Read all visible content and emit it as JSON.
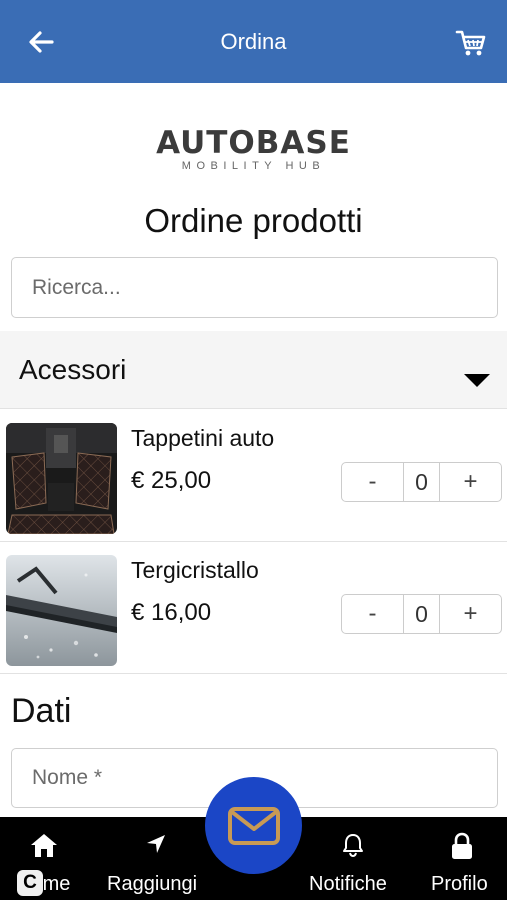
{
  "header": {
    "title": "Ordina"
  },
  "logo": {
    "brand": "AUTOBASE",
    "subtitle": "MOBILITY HUB"
  },
  "page_title": "Ordine prodotti",
  "search": {
    "placeholder": "Ricerca...",
    "value": ""
  },
  "category": {
    "label": "Acessori"
  },
  "products": [
    {
      "name": "Tappetini auto",
      "price": "€ 25,00",
      "quantity": "0",
      "minus": "-",
      "plus": "+"
    },
    {
      "name": "Tergicristallo",
      "price": "€ 16,00",
      "quantity": "0",
      "minus": "-",
      "plus": "+"
    }
  ],
  "form": {
    "section_title": "Dati",
    "name_placeholder": "Nome *"
  },
  "bottom_nav": {
    "items": [
      {
        "label": "Home",
        "icon": "home-icon"
      },
      {
        "label": "Raggiungi",
        "icon": "navigation-arrow-icon"
      },
      {
        "label": "Notifiche",
        "icon": "bell-icon"
      },
      {
        "label": "Profilo",
        "icon": "lock-icon"
      }
    ],
    "fab_icon": "mail-icon"
  },
  "overlay_badge": "C",
  "colors": {
    "header": "#3a6db5",
    "fab": "#1b46c6",
    "fab_icon": "#c89a55",
    "bottom_nav": "#000000"
  }
}
